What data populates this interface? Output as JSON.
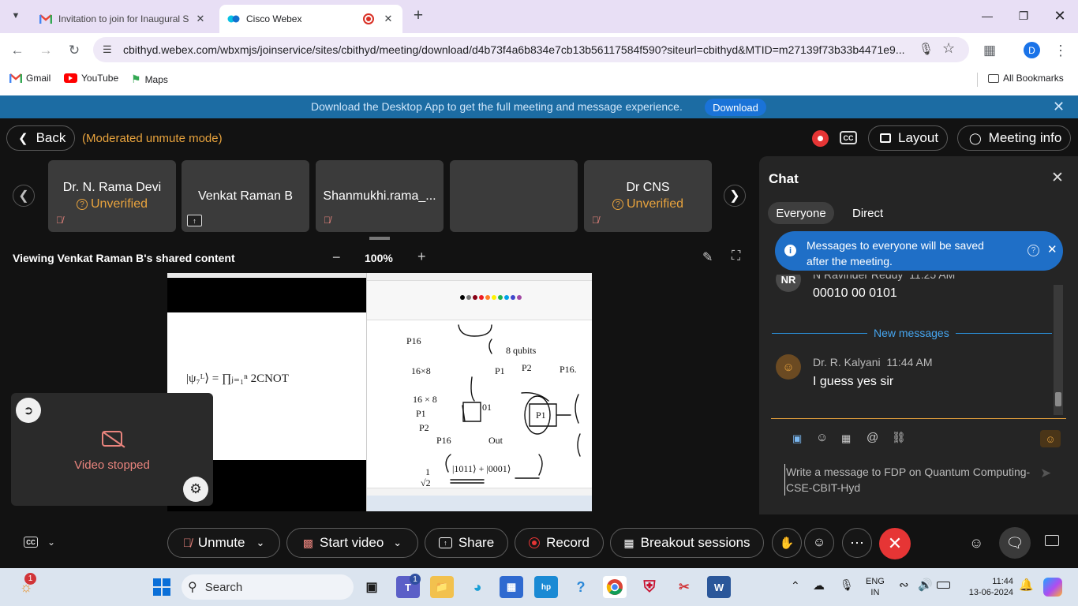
{
  "browser": {
    "tabs": [
      {
        "title": "Invitation to join for Inaugural S",
        "active": false
      },
      {
        "title": "Cisco Webex",
        "active": true
      }
    ],
    "url": "cbithyd.webex.com/wbxmjs/joinservice/sites/cbithyd/meeting/download/d4b73f4a6b834e7cb13b56117584f590?siteurl=cbithyd&MTID=m27139f73b33b4471e9...",
    "profile_initial": "D",
    "bookmarks": [
      "Gmail",
      "YouTube",
      "Maps"
    ],
    "all_bookmarks": "All Bookmarks"
  },
  "banner": {
    "text": "Download the Desktop App to get the full meeting and message experience.",
    "button": "Download"
  },
  "meeting": {
    "back": "Back",
    "mode": "(Moderated unmute mode)",
    "layout": "Layout",
    "meeting_info": "Meeting info",
    "participants": [
      {
        "name": "Dr. N. Rama Devi",
        "status": "Unverified",
        "muted": true
      },
      {
        "name": "Venkat Raman B",
        "status": "",
        "sharing": true
      },
      {
        "name": "Shanmukhi.rama_...",
        "status": "",
        "muted": true
      },
      {
        "name": "",
        "status": ""
      },
      {
        "name": "Dr CNS",
        "status": "Unverified",
        "muted": true
      }
    ],
    "viewing": "Viewing Venkat Raman B's shared content",
    "zoom": "100%",
    "self_view_status": "Video stopped",
    "shared_equation": "|ψ₇ᴸ⟩ = ∏ⱼ₌₁ⁿ 2CNOT",
    "handwriting": [
      "P16",
      "16×8",
      "P1",
      "P2",
      "P16",
      "Out",
      "8 qubits",
      "1/√2 ( |1011⟩ + |0001⟩ )"
    ]
  },
  "chat": {
    "title": "Chat",
    "tabs": [
      "Everyone",
      "Direct"
    ],
    "notice": "Messages to everyone will be saved after the meeting.",
    "messages": [
      {
        "initials": "NR",
        "sender": "N Ravinder Reddy",
        "time": "11:25 AM",
        "text": "00010 00 0101"
      },
      {
        "sender": "Dr. R. Kalyani",
        "time": "11:44 AM",
        "text": "I guess yes sir"
      }
    ],
    "new_messages": "New messages",
    "placeholder": "Write a message to FDP on Quantum Computing-CSE-CBIT-Hyd"
  },
  "controls": {
    "unmute": "Unmute",
    "start_video": "Start video",
    "share": "Share",
    "record": "Record",
    "breakout": "Breakout sessions"
  },
  "taskbar": {
    "search": "Search",
    "lang_top": "ENG",
    "lang_bottom": "IN",
    "time": "11:44",
    "date": "13-06-2024",
    "badge_widgets": "1",
    "badge_teams": "1"
  },
  "colors": {
    "webex_red": "#e63535",
    "accent_orange": "#e8a33d",
    "chat_blue": "#1f6fc7",
    "banner_blue": "#1c6ca3"
  }
}
